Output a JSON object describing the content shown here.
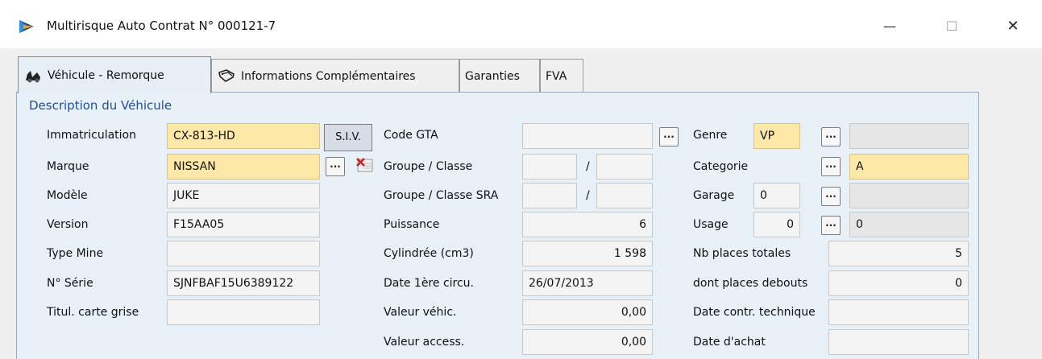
{
  "window": {
    "title": "Multirisque Auto Contrat N° 000121-7",
    "minimize": "—",
    "maximize": "☐",
    "close": "✕"
  },
  "tabs": [
    {
      "label": "Véhicule - Remorque",
      "icon": "car-icon",
      "active": true
    },
    {
      "label": "Informations Complémentaires",
      "icon": "tags-icon",
      "active": false
    },
    {
      "label": "Garanties",
      "active": false
    },
    {
      "label": "FVA",
      "active": false
    }
  ],
  "section": {
    "title": "Description du Véhicule"
  },
  "buttons": {
    "siv": "S.I.V.",
    "dots": "..."
  },
  "left": {
    "immatriculation": {
      "label": "Immatriculation",
      "value": "CX-813-HD"
    },
    "marque": {
      "label": "Marque",
      "value": "NISSAN"
    },
    "modele": {
      "label": "Modèle",
      "value": "JUKE"
    },
    "version": {
      "label": "Version",
      "value": "F15AA05"
    },
    "type_mine": {
      "label": "Type Mine",
      "value": ""
    },
    "serie": {
      "label": "N° Série",
      "value": "SJNFBAF15U6389122"
    },
    "titulaire": {
      "label": "Titul. carte grise",
      "value": ""
    }
  },
  "middle": {
    "code_gta": {
      "label": "Code GTA",
      "value": ""
    },
    "groupe_classe": {
      "label": "Groupe / Classe",
      "groupe": "",
      "classe": "",
      "sep": "/"
    },
    "groupe_classe_sra": {
      "label": "Groupe / Classe SRA",
      "groupe": "",
      "classe": "",
      "sep": "/"
    },
    "puissance": {
      "label": "Puissance",
      "value": "6"
    },
    "cylindree": {
      "label": "Cylindrée (cm3)",
      "value": "1 598"
    },
    "date_circu": {
      "label": "Date 1ère circu.",
      "value": "26/07/2013"
    },
    "valeur_vehic": {
      "label": "Valeur véhic.",
      "value": "0,00"
    },
    "valeur_access": {
      "label": "Valeur access.",
      "value": "0,00"
    }
  },
  "right": {
    "genre": {
      "label": "Genre",
      "value": "VP",
      "desc": ""
    },
    "categorie": {
      "label": "Categorie",
      "value": "A"
    },
    "garage": {
      "label": "Garage",
      "value": "0",
      "desc": ""
    },
    "usage": {
      "label": "Usage",
      "value": "0",
      "desc": "0"
    },
    "nb_places": {
      "label": "Nb places totales",
      "value": "5"
    },
    "places_debout": {
      "label": "dont places debouts",
      "value": "0"
    },
    "date_controle": {
      "label": "Date contr. technique",
      "value": ""
    },
    "date_achat": {
      "label": "Date d'achat",
      "value": ""
    }
  }
}
